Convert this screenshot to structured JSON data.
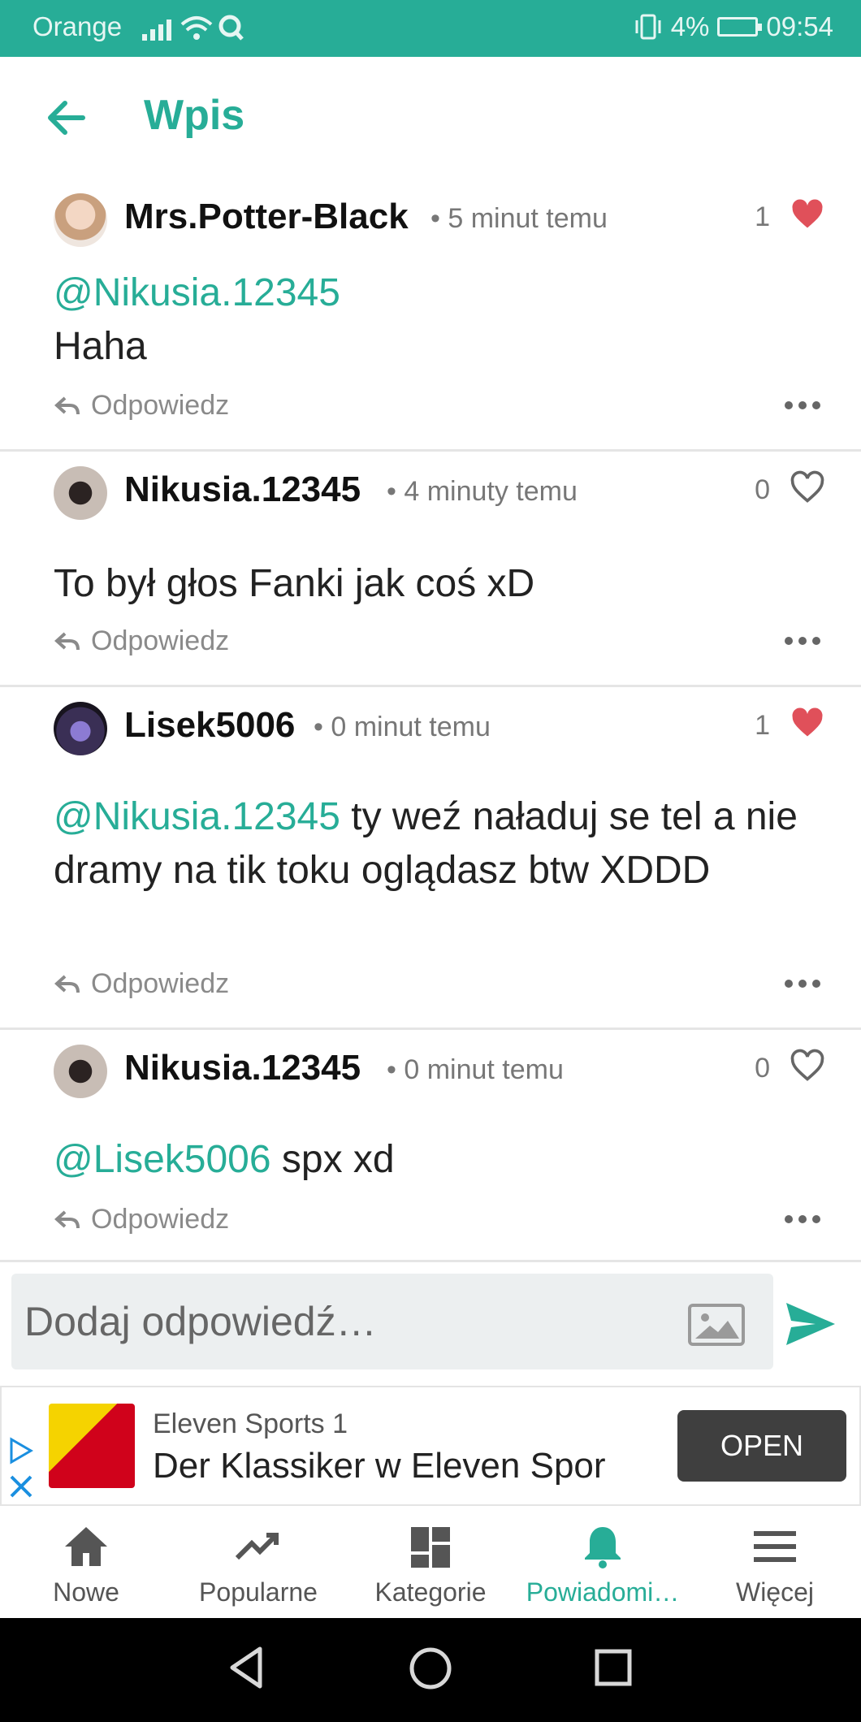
{
  "status_bar": {
    "carrier": "Orange",
    "battery": "4%",
    "time": "09:54"
  },
  "header": {
    "title": "Wpis"
  },
  "comments": [
    {
      "author": "Mrs.Potter-Black",
      "time": "• 5 minut temu",
      "likes": "1",
      "liked": true,
      "mention": "@Nikusia.12345",
      "text": "Haha",
      "reply": "Odpowiedz"
    },
    {
      "author": "Nikusia.12345",
      "time": "• 4 minuty temu",
      "likes": "0",
      "liked": false,
      "mention": "",
      "text": "To był głos Fanki jak coś xD",
      "reply": "Odpowiedz"
    },
    {
      "author": "Lisek5006",
      "time": "• 0 minut temu",
      "likes": "1",
      "liked": true,
      "mention": "@Nikusia.12345",
      "text": " ty weź naładuj se tel a nie dramy na tik toku oglądasz btw XDDD",
      "reply": "Odpowiedz"
    },
    {
      "author": "Nikusia.12345",
      "time": "• 0 minut temu",
      "likes": "0",
      "liked": false,
      "mention": "@Lisek5006",
      "text": " spx xd",
      "reply": "Odpowiedz"
    }
  ],
  "reply_input": {
    "placeholder": "Dodaj odpowiedź…"
  },
  "ad": {
    "title": "Eleven Sports 1",
    "text": "Der Klassiker w Eleven Spor",
    "button": "OPEN"
  },
  "bottom_nav": [
    {
      "label": "Nowe",
      "icon": "home-icon"
    },
    {
      "label": "Popularne",
      "icon": "trending-icon"
    },
    {
      "label": "Kategorie",
      "icon": "dashboard-icon"
    },
    {
      "label": "Powiadomi…",
      "icon": "bell-icon",
      "active": true
    },
    {
      "label": "Więcej",
      "icon": "menu-icon"
    }
  ],
  "colors": {
    "accent": "#27ad97",
    "like": "#e0505a"
  }
}
